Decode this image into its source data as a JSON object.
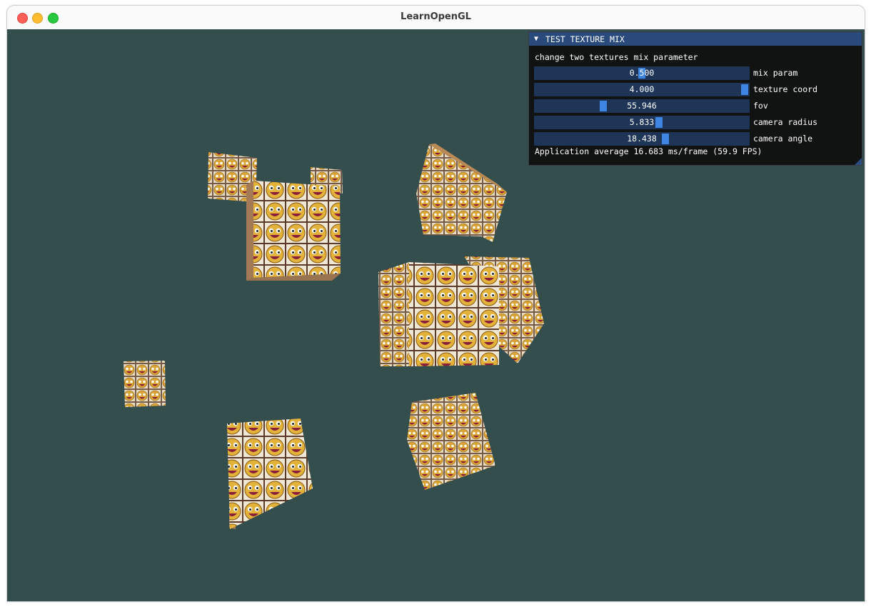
{
  "window": {
    "title": "LearnOpenGL"
  },
  "colors": {
    "background": "#344d4d",
    "panel_title_bar": "#294a7a",
    "slider_frame": "#1f3557",
    "slider_grab": "#3d85e0",
    "traffic_close": "#ff5f57",
    "traffic_minimize": "#febc2e",
    "traffic_maximize": "#28c840"
  },
  "panel": {
    "title": "TEST TEXTURE MIX",
    "collapse_icon": "triangle-down-icon",
    "hint": "change two textures mix parameter",
    "sliders": [
      {
        "value": "0.500",
        "label": "mix param",
        "fraction": 0.5
      },
      {
        "value": "4.000",
        "label": "texture coord",
        "fraction": 1.0
      },
      {
        "value": "55.946",
        "label": "fov",
        "fraction": 0.32
      },
      {
        "value": "5.833",
        "label": "camera radius",
        "fraction": 0.58
      },
      {
        "value": "18.438",
        "label": "camera angle",
        "fraction": 0.61
      }
    ],
    "stats": "Application average 16.683 ms/frame (59.9 FPS)"
  }
}
